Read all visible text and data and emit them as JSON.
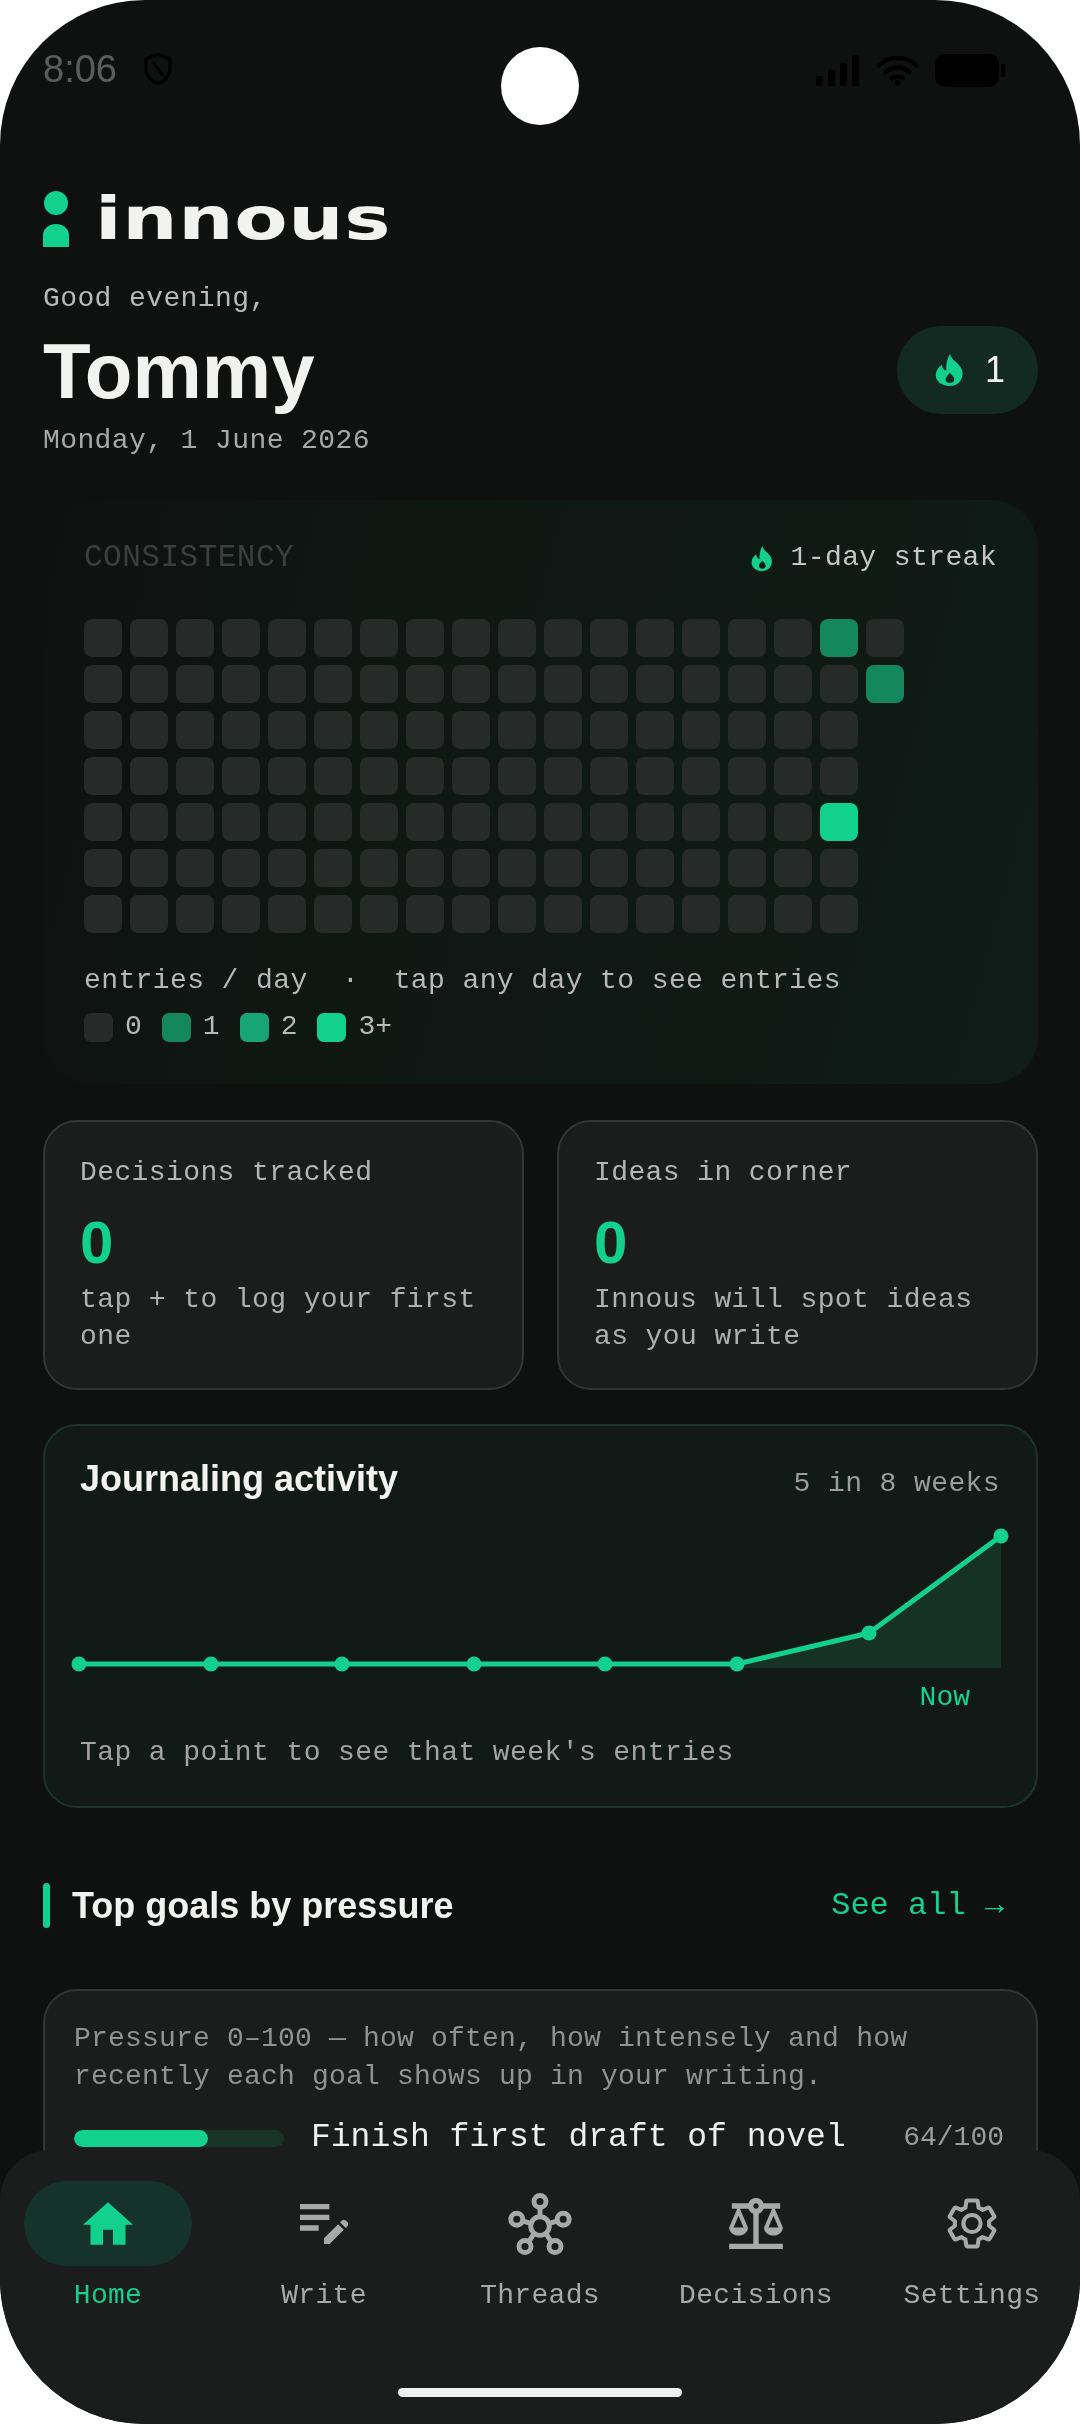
{
  "status_bar": {
    "time": "8:06"
  },
  "header": {
    "logo_text": "innous",
    "greeting": "Good evening,",
    "name": "Tommy",
    "date": "Monday, 1 June 2026",
    "streak_badge": {
      "count": "1"
    }
  },
  "consistency": {
    "title": "CONSISTENCY",
    "streak": "1-day streak",
    "weeks": [
      [
        {
          "color": "#262a28"
        },
        {
          "color": "#262a28"
        },
        {
          "color": "#262a28"
        },
        {
          "color": "#262a28"
        },
        {
          "color": "#262a28"
        },
        {
          "color": "#262a28"
        },
        {
          "color": "#262a28"
        }
      ],
      [
        {
          "color": "#262a28"
        },
        {
          "color": "#262a28"
        },
        {
          "color": "#262a28"
        },
        {
          "color": "#262a28"
        },
        {
          "color": "#262a28"
        },
        {
          "color": "#262a28"
        },
        {
          "color": "#262a28"
        }
      ],
      [
        {
          "color": "#262a28"
        },
        {
          "color": "#262a28"
        },
        {
          "color": "#262a28"
        },
        {
          "color": "#262a28"
        },
        {
          "color": "#262a28"
        },
        {
          "color": "#262a28"
        },
        {
          "color": "#262a28"
        }
      ],
      [
        {
          "color": "#262a28"
        },
        {
          "color": "#262a28"
        },
        {
          "color": "#262a28"
        },
        {
          "color": "#262a28"
        },
        {
          "color": "#262a28"
        },
        {
          "color": "#262a28"
        },
        {
          "color": "#262a28"
        }
      ],
      [
        {
          "color": "#262a28"
        },
        {
          "color": "#262a28"
        },
        {
          "color": "#262a28"
        },
        {
          "color": "#262a28"
        },
        {
          "color": "#262a28"
        },
        {
          "color": "#262a28"
        },
        {
          "color": "#262a28"
        }
      ],
      [
        {
          "color": "#262a28"
        },
        {
          "color": "#262a28"
        },
        {
          "color": "#262a28"
        },
        {
          "color": "#262a28"
        },
        {
          "color": "#262a28"
        },
        {
          "color": "#262a28"
        },
        {
          "color": "#262a28"
        }
      ],
      [
        {
          "color": "#262a28"
        },
        {
          "color": "#262a28"
        },
        {
          "color": "#262a28"
        },
        {
          "color": "#262a28"
        },
        {
          "color": "#262a28"
        },
        {
          "color": "#262a28"
        },
        {
          "color": "#262a28"
        }
      ],
      [
        {
          "color": "#262a28"
        },
        {
          "color": "#262a28"
        },
        {
          "color": "#262a28"
        },
        {
          "color": "#262a28"
        },
        {
          "color": "#262a28"
        },
        {
          "color": "#262a28"
        },
        {
          "color": "#262a28"
        }
      ],
      [
        {
          "color": "#262a28"
        },
        {
          "color": "#262a28"
        },
        {
          "color": "#262a28"
        },
        {
          "color": "#262a28"
        },
        {
          "color": "#262a28"
        },
        {
          "color": "#262a28"
        },
        {
          "color": "#262a28"
        }
      ],
      [
        {
          "color": "#262a28"
        },
        {
          "color": "#262a28"
        },
        {
          "color": "#262a28"
        },
        {
          "color": "#262a28"
        },
        {
          "color": "#262a28"
        },
        {
          "color": "#262a28"
        },
        {
          "color": "#262a28"
        }
      ],
      [
        {
          "color": "#262a28"
        },
        {
          "color": "#262a28"
        },
        {
          "color": "#262a28"
        },
        {
          "color": "#262a28"
        },
        {
          "color": "#262a28"
        },
        {
          "color": "#262a28"
        },
        {
          "color": "#262a28"
        }
      ],
      [
        {
          "color": "#262a28"
        },
        {
          "color": "#262a28"
        },
        {
          "color": "#262a28"
        },
        {
          "color": "#262a28"
        },
        {
          "color": "#262a28"
        },
        {
          "color": "#262a28"
        },
        {
          "color": "#262a28"
        }
      ],
      [
        {
          "color": "#262a28"
        },
        {
          "color": "#262a28"
        },
        {
          "color": "#262a28"
        },
        {
          "color": "#262a28"
        },
        {
          "color": "#262a28"
        },
        {
          "color": "#262a28"
        },
        {
          "color": "#262a28"
        }
      ],
      [
        {
          "color": "#262a28"
        },
        {
          "color": "#262a28"
        },
        {
          "color": "#262a28"
        },
        {
          "color": "#262a28"
        },
        {
          "color": "#262a28"
        },
        {
          "color": "#262a28"
        },
        {
          "color": "#262a28"
        }
      ],
      [
        {
          "color": "#262a28"
        },
        {
          "color": "#262a28"
        },
        {
          "color": "#262a28"
        },
        {
          "color": "#262a28"
        },
        {
          "color": "#262a28"
        },
        {
          "color": "#262a28"
        },
        {
          "color": "#262a28"
        }
      ],
      [
        {
          "color": "#262a28"
        },
        {
          "color": "#262a28"
        },
        {
          "color": "#262a28"
        },
        {
          "color": "#262a28"
        },
        {
          "color": "#262a28"
        },
        {
          "color": "#262a28"
        },
        {
          "color": "#262a28"
        }
      ],
      [
        {
          "color": "#15875f"
        },
        {
          "color": "#262a28"
        },
        {
          "color": "#262a28"
        },
        {
          "color": "#262a28"
        },
        {
          "color": "#12d18e"
        },
        {
          "color": "#262a28"
        },
        {
          "color": "#262a28"
        }
      ],
      [
        {
          "color": "#262a28"
        },
        {
          "color": "#15875f"
        }
      ]
    ],
    "hint": "entries / day  ·  tap any day to see entries",
    "legend": [
      {
        "label": "0",
        "color": "#262a28"
      },
      {
        "label": "1",
        "color": "#15875f"
      },
      {
        "label": "2",
        "color": "#18a576"
      },
      {
        "label": "3+",
        "color": "#12d18e"
      }
    ]
  },
  "stats": [
    {
      "label": "Decisions tracked",
      "value": "0",
      "note": "tap + to log your first one"
    },
    {
      "label": "Ideas in corner",
      "value": "0",
      "note": "Innous will spot ideas as you write"
    }
  ],
  "activity": {
    "title": "Journaling activity",
    "summary": "5 in 8 weeks",
    "now_label": "Now",
    "hint": "Tap a point to see that week's entries"
  },
  "goals": {
    "title": "Top goals by pressure",
    "see_all": "See all →",
    "description": "Pressure 0–100 — how often, how intensely and how recently each goal shows up in your writing.",
    "items": [
      {
        "name": "Finish first draft of novel",
        "level": 0.64,
        "score": "64/100"
      }
    ]
  },
  "nav": [
    {
      "label": "Home",
      "selected": true
    },
    {
      "label": "Write",
      "selected": false
    },
    {
      "label": "Threads",
      "selected": false
    },
    {
      "label": "Decisions",
      "selected": false
    },
    {
      "label": "Settings",
      "selected": false
    }
  ]
}
